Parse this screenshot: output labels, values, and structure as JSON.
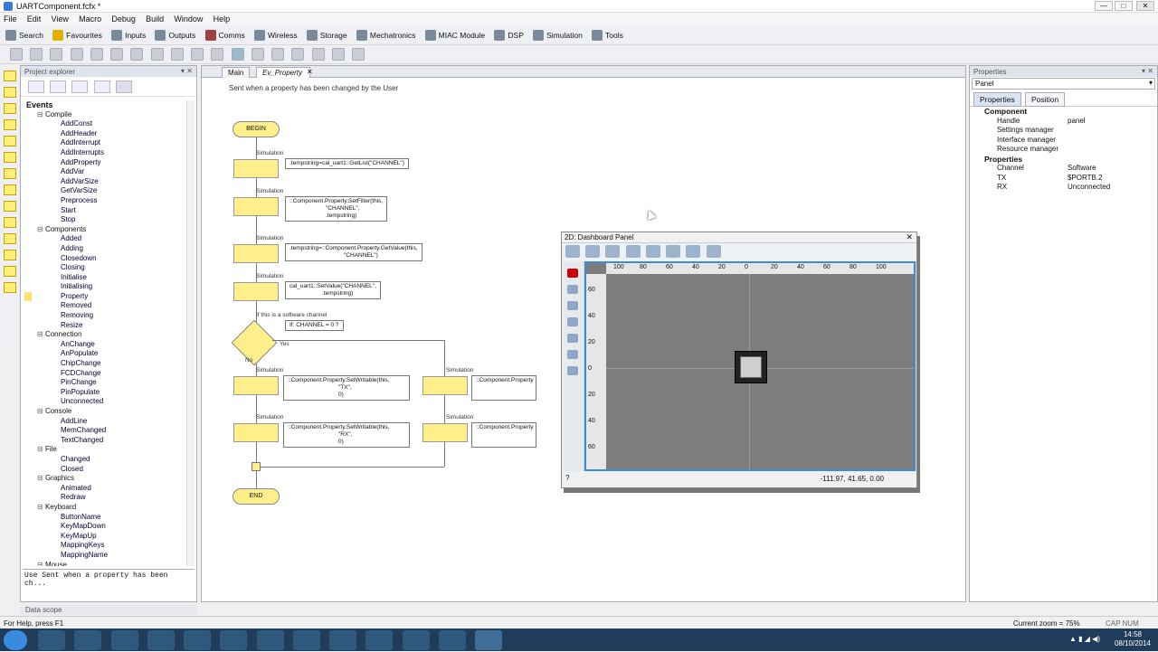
{
  "window": {
    "title": "UARTComponent.fcfx *",
    "min": "—",
    "max": "□",
    "close": "✕"
  },
  "menu": [
    "File",
    "Edit",
    "View",
    "Macro",
    "Debug",
    "Build",
    "Window",
    "Help"
  ],
  "toolbar": [
    "Search",
    "Favourites",
    "Inputs",
    "Outputs",
    "Comms",
    "Wireless",
    "Storage",
    "Mechatronics",
    "MIAC Module",
    "DSP",
    "Simulation",
    "Tools"
  ],
  "project_explorer": {
    "title": "Project explorer",
    "root": "Events",
    "groups": [
      {
        "name": "Compile",
        "items": [
          "AddConst",
          "AddHeader",
          "AddInterrupt",
          "AddInterrupts",
          "AddProperty",
          "AddVar",
          "AddVarSize",
          "GetVarSize",
          "Preprocess",
          "Start",
          "Stop"
        ]
      },
      {
        "name": "Components",
        "items": [
          "Added",
          "Adding",
          "Closedown",
          "Closing",
          "Initialise",
          "Initialising",
          "Property",
          "Removed",
          "Removing",
          "Resize"
        ]
      },
      {
        "name": "Connection",
        "items": [
          "AnChange",
          "AnPopulate",
          "ChipChange",
          "FCDChange",
          "PinChange",
          "PinPopulate",
          "Unconnected"
        ]
      },
      {
        "name": "Console",
        "items": [
          "AddLine",
          "MemChanged",
          "TextChanged"
        ]
      },
      {
        "name": "File",
        "items": [
          "Changed",
          "Closed"
        ]
      },
      {
        "name": "Graphics",
        "items": [
          "Animated",
          "Redraw"
        ]
      },
      {
        "name": "Keyboard",
        "items": [
          "ButtonName",
          "KeyMapDown",
          "KeyMapUp",
          "MappingKeys",
          "MappingName"
        ]
      },
      {
        "name": "Mouse",
        "items": []
      }
    ],
    "description": "Use Sent when a property has been ch...",
    "data_scope": "Data scope"
  },
  "editor": {
    "tabs": [
      "Main",
      "Ev_Property"
    ],
    "tab_close": "✕",
    "description": "Sent when a property has been changed by the User",
    "begin": "BEGIN",
    "end": "END",
    "sim_label": "Simulation",
    "comment": "If this is a software channel",
    "decision": "If: CHANNEL = 0 ?",
    "yes": "Yes",
    "no": "No",
    "code1": ".tempstring=cal_uart1::GetList(\"CHANNEL\")",
    "code2a": "::Component.Property.SetFilter(this,",
    "code2b": "\"CHANNEL\",",
    "code2c": ".tempstring)",
    "code3a": ".tempstring=::Component.Property.GetValue(this,",
    "code3b": "\"CHANNEL\")",
    "code4a": "cal_uart1::SetValue(\"CHANNEL\",",
    "code4b": ".tempstring)",
    "code5a": "::Component.Property.SetWritable(this,",
    "code5b": "\"TX\",",
    "code5c": "0)",
    "code6a": "::Component.Property.SetWritable(this,",
    "code6b": "\"RX\",",
    "code6c": "0)",
    "code7": "::Component.Property",
    "code8": "::Component.Property"
  },
  "dashboard": {
    "title": "2D: Dashboard Panel",
    "close": "✕",
    "mode": "2D",
    "ruler_top": [
      "100",
      "80",
      "60",
      "40",
      "20",
      "0",
      "20",
      "40",
      "60",
      "80",
      "100"
    ],
    "ruler_left": [
      "60",
      "40",
      "20",
      "0",
      "20",
      "40",
      "60"
    ],
    "coords": "-111.97, 41.65, 0.00"
  },
  "properties": {
    "title": "Properties",
    "selector": "Panel",
    "tabs": [
      "Properties",
      "Position"
    ],
    "rows": [
      {
        "group": true,
        "key": "Component",
        "value": ""
      },
      {
        "key": "Handle",
        "value": "panel"
      },
      {
        "key": "Settings manager",
        "value": ""
      },
      {
        "key": "Interface manager",
        "value": ""
      },
      {
        "key": "Resource manager",
        "value": ""
      },
      {
        "group": true,
        "key": "Properties",
        "value": ""
      },
      {
        "key": "Channel",
        "value": "Software"
      },
      {
        "key": "TX",
        "value": "$PORTB.2"
      },
      {
        "key": "RX",
        "value": "Unconnected"
      }
    ]
  },
  "status": {
    "help": "For Help, press F1",
    "zoom": "Current zoom = 75%",
    "keys": "CAP  NUM  SCRL"
  },
  "taskbar": {
    "time": "14:58",
    "date": "08/10/2014"
  }
}
